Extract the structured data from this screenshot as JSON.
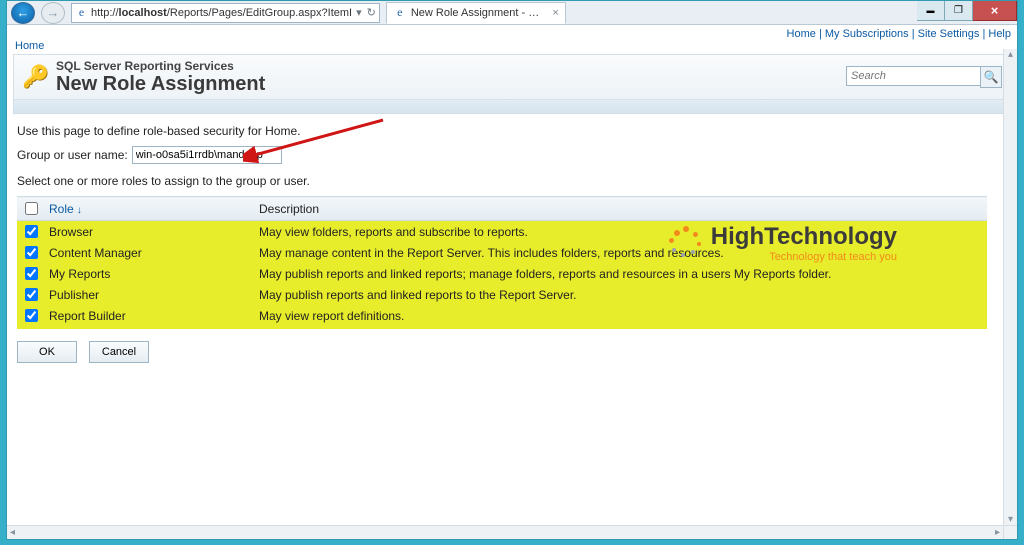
{
  "window": {
    "url_prefix": "http://",
    "url_host": "localhost",
    "url_path": "/Reports/Pages/EditGroup.aspx?ItemI",
    "tab_title": "New Role Assignment - Re..."
  },
  "ssrs_links": {
    "home": "Home",
    "subs": "My Subscriptions",
    "site": "Site Settings",
    "help": "Help"
  },
  "breadcrumb": {
    "home": "Home"
  },
  "header": {
    "service": "SQL Server Reporting Services",
    "title": "New Role Assignment",
    "search_placeholder": "Search"
  },
  "content": {
    "intro": "Use this page to define role-based security for Home.",
    "group_label": "Group or user name:",
    "group_value": "win-o0sa5i1rrdb\\mandeep",
    "select_roles": "Select one or more roles to assign to the group or user.",
    "col_role": "Role",
    "col_desc": "Description",
    "ok": "OK",
    "cancel": "Cancel"
  },
  "roles": [
    {
      "name": "Browser",
      "desc": "May view folders, reports and subscribe to reports."
    },
    {
      "name": "Content Manager",
      "desc": "May manage content in the Report Server.  This includes folders, reports and resources."
    },
    {
      "name": "My Reports",
      "desc": "May publish reports and linked reports; manage folders, reports and resources in a users My Reports folder."
    },
    {
      "name": "Publisher",
      "desc": "May publish reports and linked reports to the Report Server."
    },
    {
      "name": "Report Builder",
      "desc": "May view report definitions."
    }
  ],
  "logo": {
    "big": "HighTechnology",
    "small": "Technology that teach you"
  }
}
